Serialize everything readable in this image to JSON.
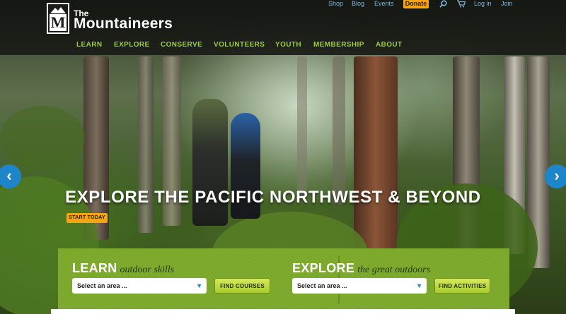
{
  "brand": {
    "the": "The",
    "name": "Mountaineers",
    "mark": "M"
  },
  "utility": {
    "shop": "Shop",
    "blog": "Blog",
    "events": "Events",
    "donate": "Donate",
    "search_icon": "search-icon",
    "cart_icon": "cart-icon",
    "login": "Log in",
    "join": "Join"
  },
  "nav": [
    "LEARN",
    "EXPLORE",
    "CONSERVE",
    "VOLUNTEERS",
    "YOUTH",
    "MEMBERSHIP",
    "ABOUT"
  ],
  "hero": {
    "headline": "EXPLORE THE PACIFIC NORTHWEST & BEYOND",
    "cta": "START TODAY"
  },
  "slider": {
    "prev_icon": "chevron-left-icon",
    "next_icon": "chevron-right-icon"
  },
  "learn": {
    "title": "LEARN",
    "subtitle": "outdoor skills",
    "select_value": "Select an area ...",
    "button": "FIND COURSES"
  },
  "explore": {
    "title": "EXPLORE",
    "subtitle": "the great outdoors",
    "select_value": "Select an area ...",
    "button": "FIND ACTIVITIES"
  },
  "colors": {
    "accent_green": "#7ba82a",
    "nav_green": "#9ccc3c",
    "donate_orange": "#f2a516",
    "link_blue": "#7fb8e0",
    "arrow_blue": "#1e86c8"
  }
}
